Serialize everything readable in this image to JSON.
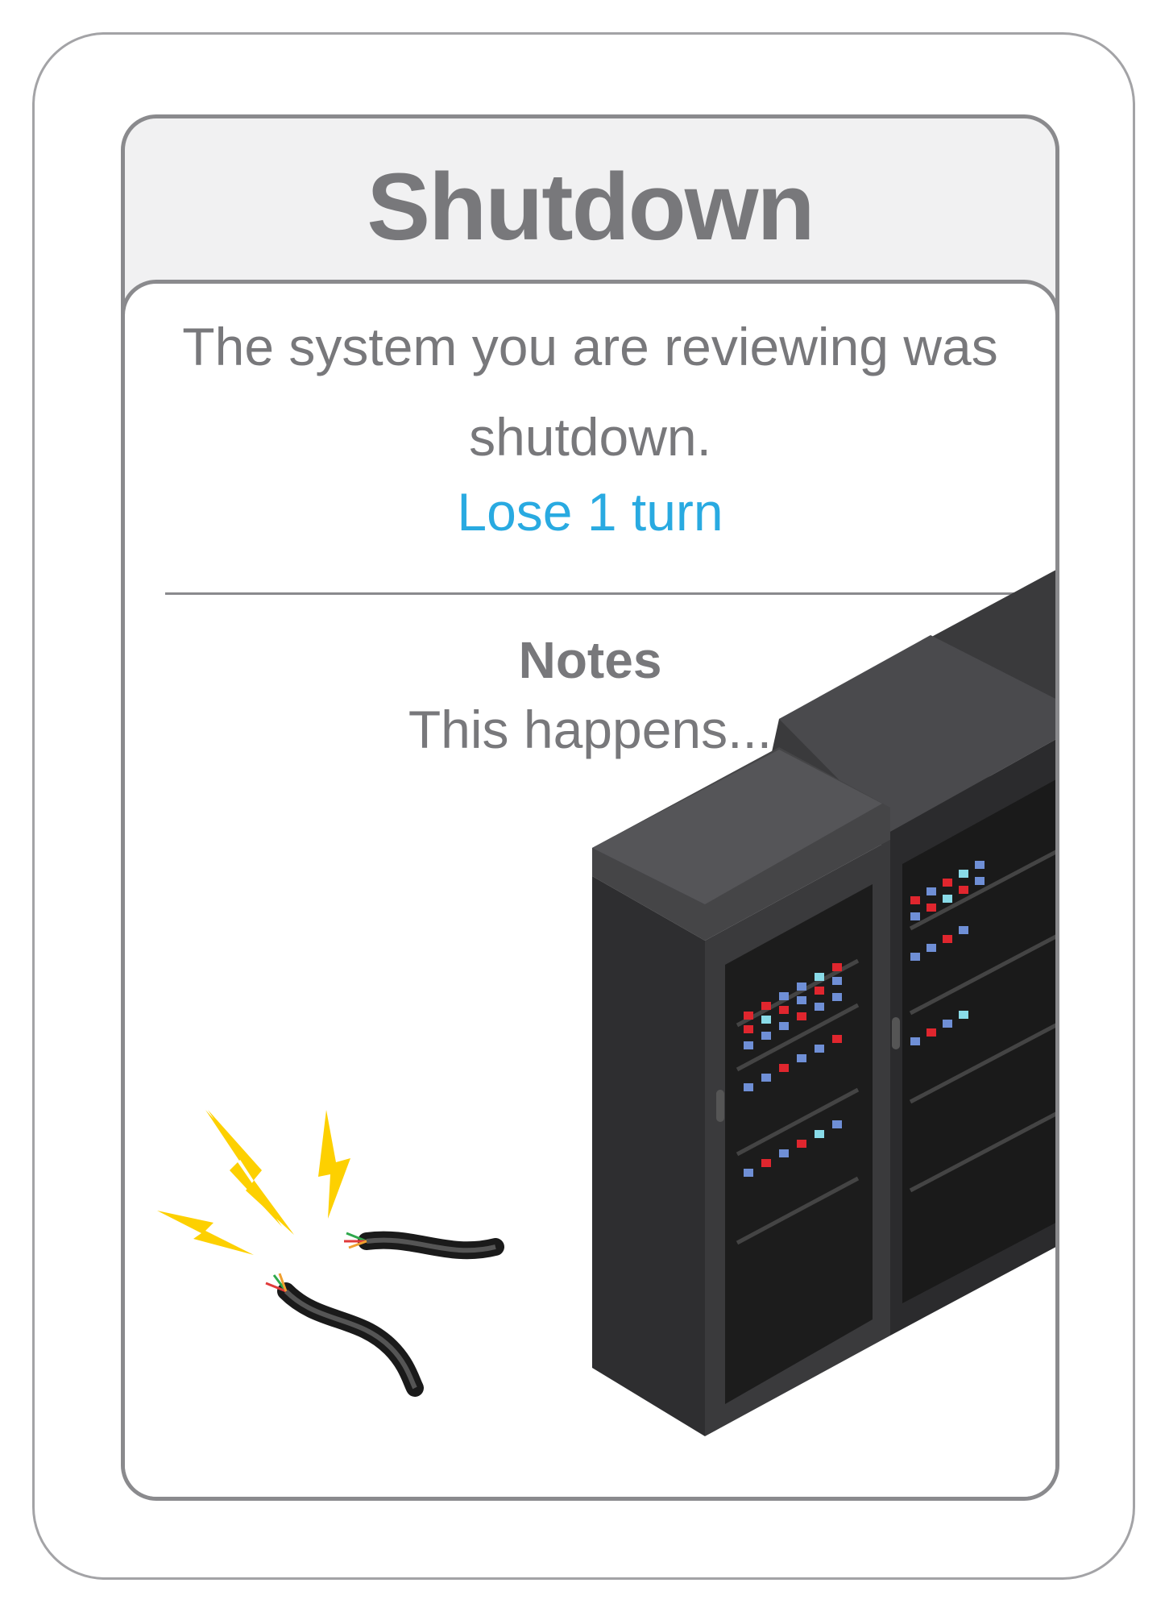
{
  "card": {
    "title": "Shutdown",
    "description": "The system you are reviewing was shutdown.",
    "penalty": "Lose 1 turn",
    "notes_title": "Notes",
    "notes_text": "This happens..."
  },
  "colors": {
    "title": "#78787b",
    "body_text": "#78787b",
    "penalty": "#29aae1",
    "border": "#8a8a8d",
    "spark": "#fdd000"
  },
  "illustration": {
    "subject": "server-rack-icon",
    "cable": "cut-cable-icon",
    "sparks": "lightning-bolt-icon"
  }
}
